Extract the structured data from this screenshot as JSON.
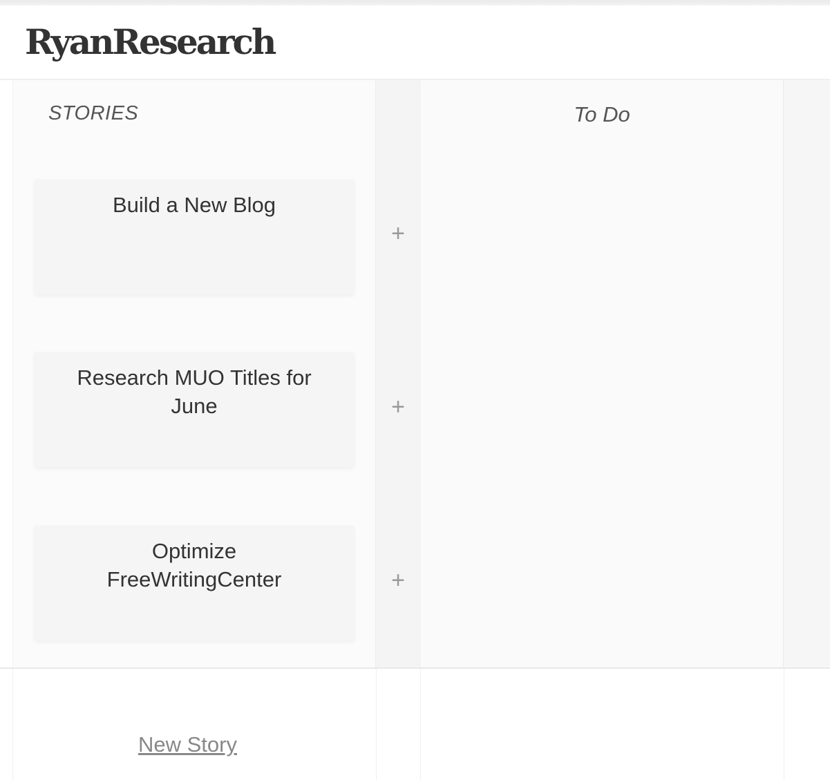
{
  "app": {
    "logo": "RyanResearch"
  },
  "board": {
    "stories_heading": "STORIES",
    "todo_heading": "To Do",
    "add_symbol": "+",
    "stories": [
      {
        "title": "Build a New Blog"
      },
      {
        "title": "Research MUO Titles for June"
      },
      {
        "title": "Optimize FreeWritingCenter"
      }
    ]
  },
  "footer": {
    "new_story_label": "New Story"
  },
  "icons": {
    "add": "plus-icon"
  },
  "colors": {
    "logo": "#333333",
    "card_bg": "#f5f5f5",
    "add_icon": "#999999",
    "link": "#888888"
  }
}
